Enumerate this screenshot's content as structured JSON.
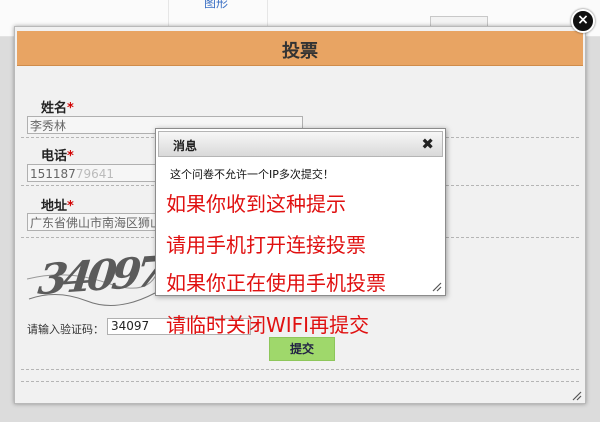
{
  "background": {
    "link_text": "图形"
  },
  "vote": {
    "title": "投票",
    "required_mark": "*",
    "fields": [
      {
        "label": "姓名",
        "value": "李秀林"
      },
      {
        "label": "电话",
        "value": "151187",
        "blurred_tail": "79641"
      },
      {
        "label": "地址",
        "value": "广东省佛山市南海区狮山"
      }
    ],
    "captcha": {
      "image_text": "34097",
      "label": "请输入验证码：",
      "value": "34097"
    },
    "submit_label": "提交",
    "close_symbol": "×"
  },
  "message": {
    "title": "消息",
    "close_symbol": "✖",
    "text": "这个问卷不允许一个IP多次提交！"
  },
  "annotations": [
    "如果你收到这种提示",
    "请用手机打开连接投票",
    "如果你正在使用手机投票",
    "请临时关闭WIFI再提交"
  ],
  "colors": {
    "header_orange": "#e8a463",
    "submit_green": "#9fd86b",
    "annotation_red": "#e01010"
  }
}
